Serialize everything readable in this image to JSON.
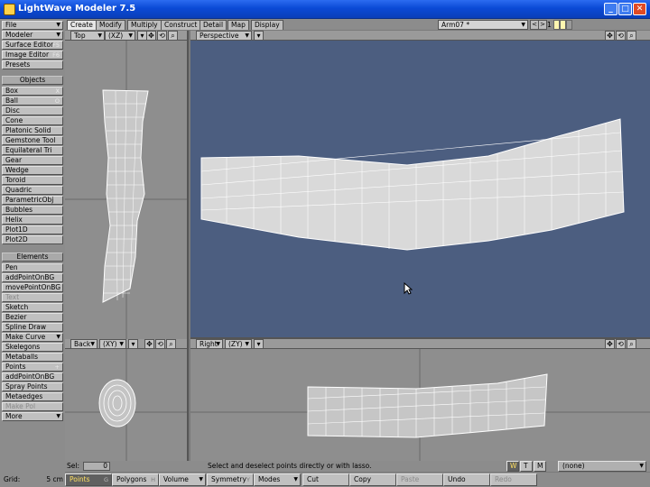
{
  "window": {
    "title": "LightWave Modeler 7.5",
    "controls": {
      "minimize": "_",
      "maximize": "□",
      "close": "✕"
    }
  },
  "left_panel": {
    "top_menus": [
      {
        "label": "File"
      },
      {
        "label": "Modeler"
      },
      {
        "label": "Surface Editor",
        "shortcut": "F5"
      },
      {
        "label": "Image Editor",
        "shortcut": "F6"
      },
      {
        "label": "Presets"
      }
    ],
    "objects_header": "Objects",
    "objects": [
      {
        "label": "Box",
        "shortcut": "X"
      },
      {
        "label": "Ball",
        "shortcut": "O"
      },
      {
        "label": "Disc"
      },
      {
        "label": "Cone"
      },
      {
        "label": "Platonic Solid"
      },
      {
        "label": "Gemstone Tool"
      },
      {
        "label": "Equilateral Tri"
      },
      {
        "label": "Gear"
      },
      {
        "label": "Wedge"
      },
      {
        "label": "Toroid"
      },
      {
        "label": "Quadric"
      },
      {
        "label": "ParametricObj"
      },
      {
        "label": "Bubbles"
      },
      {
        "label": "Helix"
      },
      {
        "label": "Plot1D"
      },
      {
        "label": "Plot2D"
      }
    ],
    "elements_header": "Elements",
    "elements": [
      {
        "label": "Pen"
      },
      {
        "label": "addPointOnBG"
      },
      {
        "label": "movePointOnBG"
      },
      {
        "label": "Text",
        "disabled": true
      },
      {
        "label": "Sketch"
      },
      {
        "label": "Bezier"
      },
      {
        "label": "Spline Draw"
      },
      {
        "label": "Make Curve",
        "dropdown": true
      },
      {
        "label": "Skelegons"
      },
      {
        "label": "Metaballs"
      },
      {
        "label": "Points",
        "shortcut": "+"
      },
      {
        "label": "addPointOnBG"
      },
      {
        "label": "Spray Points"
      },
      {
        "label": "Metaedges"
      },
      {
        "label": "Make Pol",
        "disabled": true
      },
      {
        "label": "More",
        "dropdown": true
      }
    ]
  },
  "tabs": [
    "Create",
    "Modify",
    "Multiply",
    "Construct",
    "Detail",
    "Map",
    "Display"
  ],
  "active_tab": "Create",
  "layer": {
    "object_name": "Arm07 *",
    "prev": "<",
    "next": ">",
    "number": "1"
  },
  "viewports": {
    "top_left": {
      "view": "Top",
      "axes": "(XZ)"
    },
    "top_right": {
      "view": "Perspective"
    },
    "bottom_left": {
      "view": "Back",
      "axes": "(XY)"
    },
    "bottom_right": {
      "view": "Right",
      "axes": "(ZY)"
    }
  },
  "status": {
    "sel_label": "Sel:",
    "sel_value": "0",
    "message": "Select and deselect points directly or with lasso.",
    "wtm": [
      "W",
      "T",
      "M"
    ],
    "surface": "(none)"
  },
  "bottom_bar": {
    "grid_label": "Grid:",
    "grid_value": "5 cm",
    "modes": [
      {
        "label": "Points",
        "hint": "G",
        "active": true
      },
      {
        "label": "Polygons",
        "hint": "H"
      },
      {
        "label": "Volume",
        "dropdown": true
      },
      {
        "label": "Symmetry",
        "hint": "Y"
      },
      {
        "label": "Modes",
        "dropdown": true
      },
      {
        "label": "Cut"
      },
      {
        "label": "Copy"
      },
      {
        "label": "Paste",
        "disabled": true
      },
      {
        "label": "Undo"
      },
      {
        "label": "Redo",
        "disabled": true
      }
    ]
  },
  "colors": {
    "viewport_ortho_bg": "#8e8e8e",
    "viewport_perspective_bg": "#4c5e80",
    "wireframe": "#ffffff",
    "title_bar": "#0b4ad6"
  }
}
